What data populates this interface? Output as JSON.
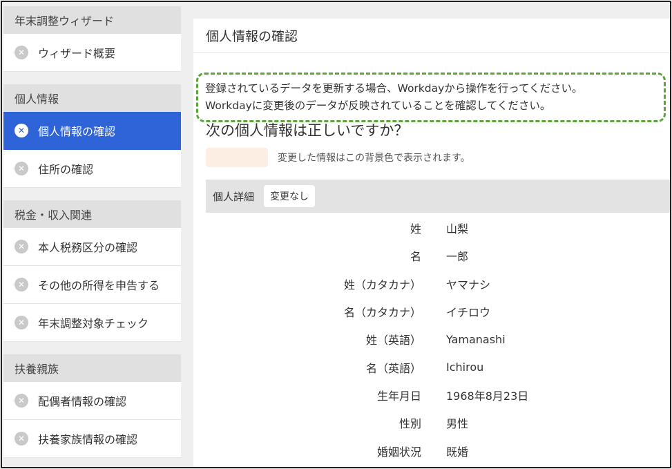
{
  "sidebar": {
    "sections": [
      {
        "header": "年末調整ウィザード",
        "items": [
          {
            "label": "ウィザード概要",
            "active": false
          }
        ]
      },
      {
        "header": "個人情報",
        "items": [
          {
            "label": "個人情報の確認",
            "active": true
          },
          {
            "label": "住所の確認",
            "active": false
          }
        ]
      },
      {
        "header": "税金・収入関連",
        "items": [
          {
            "label": "本人税務区分の確認",
            "active": false
          },
          {
            "label": "その他の所得を申告する",
            "active": false
          },
          {
            "label": "年末調整対象チェック",
            "active": false
          }
        ]
      },
      {
        "header": "扶養親族",
        "items": [
          {
            "label": "配偶者情報の確認",
            "active": false
          },
          {
            "label": "扶養家族情報の確認",
            "active": false
          }
        ]
      }
    ],
    "item_icon": "x-circle-icon",
    "active_color": "#2f64d8"
  },
  "main": {
    "title": "個人情報の確認",
    "notice": {
      "line1": "登録されているデータを更新する場合、Workdayから操作を行ってください。",
      "line2": "Workdayに変更後のデータが反映されていることを確認してください。",
      "border_color": "#5aa53a"
    },
    "question": "次の個人情報は正しいですか？",
    "legend": {
      "text": "変更した情報はこの背景色で表示されます。",
      "swatch_color": "#fdeee3"
    },
    "detail": {
      "title": "個人詳細",
      "tag": "変更なし",
      "rows": [
        {
          "label": "姓",
          "value": "山梨"
        },
        {
          "label": "名",
          "value": "一郎"
        },
        {
          "label": "姓（カタカナ）",
          "value": "ヤマナシ"
        },
        {
          "label": "名（カタカナ）",
          "value": "イチロウ"
        },
        {
          "label": "姓（英語）",
          "value": "Yamanashi"
        },
        {
          "label": "名（英語）",
          "value": "Ichirou"
        },
        {
          "label": "生年月日",
          "value": "1968年8月23日"
        },
        {
          "label": "性別",
          "value": "男性"
        },
        {
          "label": "婚姻状況",
          "value": "既婚"
        }
      ]
    }
  }
}
